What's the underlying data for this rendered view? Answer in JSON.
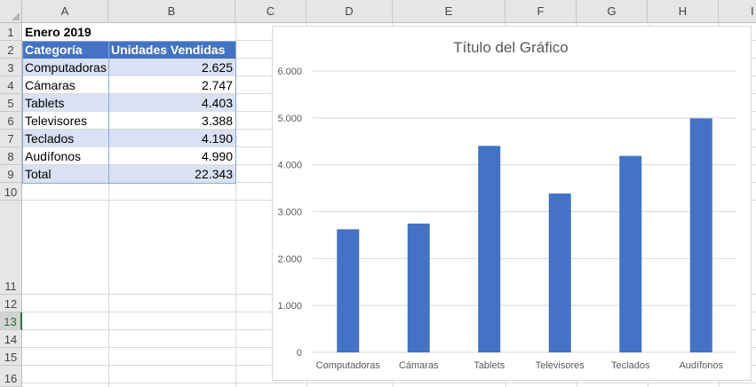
{
  "columns": [
    "A",
    "B",
    "C",
    "D",
    "E",
    "F",
    "G",
    "H",
    "I"
  ],
  "rows": [
    "1",
    "2",
    "3",
    "4",
    "5",
    "6",
    "7",
    "8",
    "9",
    "10",
    "11",
    "12",
    "13",
    "14",
    "15",
    "16"
  ],
  "active_row": "13",
  "sheet": {
    "title": "Enero 2019",
    "headers": {
      "category": "Categoría",
      "units": "Unidades Vendidas"
    },
    "items": [
      {
        "category": "Computadoras",
        "units": "2.625"
      },
      {
        "category": "Cámaras",
        "units": "2.747"
      },
      {
        "category": "Tablets",
        "units": "4.403"
      },
      {
        "category": "Televisores",
        "units": "3.388"
      },
      {
        "category": "Teclados",
        "units": "4.190"
      },
      {
        "category": "Audífonos",
        "units": "4.990"
      }
    ],
    "total": {
      "label": "Total",
      "value": "22.343"
    }
  },
  "colors": {
    "header_fill": "#4472c4",
    "band_fill": "#d9e1f2",
    "bar": "#4472c4",
    "active_row": "#217346"
  },
  "chart_data": {
    "type": "bar",
    "title": "Título del Gráfico",
    "categories": [
      "Computadoras",
      "Cámaras",
      "Tablets",
      "Televisores",
      "Teclados",
      "Audífonos"
    ],
    "values": [
      2625,
      2747,
      4403,
      3388,
      4190,
      4990
    ],
    "ylim": [
      0,
      6000
    ],
    "yticks": [
      "0",
      "1.000",
      "2.000",
      "3.000",
      "4.000",
      "5.000",
      "6.000"
    ],
    "xlabel": "",
    "ylabel": "",
    "grid": true,
    "legend": "none"
  }
}
